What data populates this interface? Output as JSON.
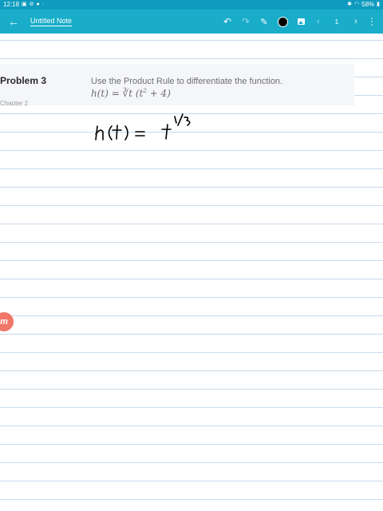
{
  "status_bar": {
    "time": "12:18",
    "battery": "58%",
    "colors": {
      "background": "#0f9bbf"
    }
  },
  "toolbar": {
    "title": "Untitled Note",
    "page_number": "1",
    "icons": [
      "back-arrow-icon",
      "undo-icon",
      "redo-icon",
      "pen-icon",
      "color-dot",
      "image-icon",
      "chevron-left-icon",
      "next-page-icon",
      "more-icon"
    ],
    "colors": {
      "background": "#19adc9",
      "ink": "#000000"
    }
  },
  "problem": {
    "title": "Problem 3",
    "chapter": "Chapter 2",
    "instruction": "Use the Product Rule to differentiate the function.",
    "formula": {
      "lhs": "h(t) = ",
      "radical": "∛t",
      "open": " (t",
      "exp": "2",
      "rest": " + 4)"
    }
  },
  "handwriting": {
    "text": "h(t) = t^(1/3)"
  },
  "badge": {
    "letter": "m"
  }
}
